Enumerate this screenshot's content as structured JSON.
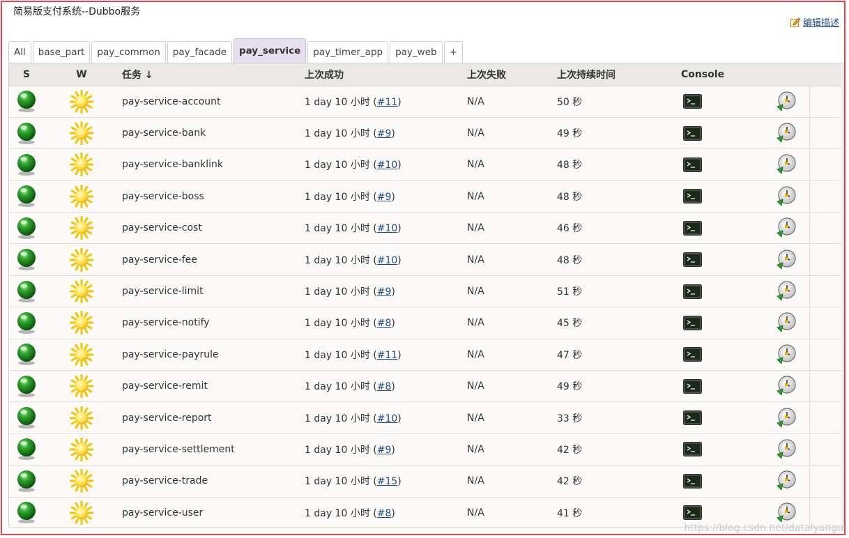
{
  "page": {
    "title": "简易版支付系统--Dubbo服务",
    "edit_description": "编辑描述",
    "watermark": "https://blog.csdn.net/datalyangu"
  },
  "tabs": [
    {
      "label": "All",
      "active": false
    },
    {
      "label": "base_part",
      "active": false
    },
    {
      "label": "pay_common",
      "active": false
    },
    {
      "label": "pay_facade",
      "active": false
    },
    {
      "label": "pay_service",
      "active": true
    },
    {
      "label": "pay_timer_app",
      "active": false
    },
    {
      "label": "pay_web",
      "active": false
    },
    {
      "label": "+",
      "active": false
    }
  ],
  "table": {
    "headers": {
      "status": "S",
      "weather": "W",
      "name": "任务 ↓",
      "last_success": "上次成功",
      "last_failure": "上次失败",
      "last_duration": "上次持续时间",
      "console": "Console"
    },
    "rows": [
      {
        "name": "pay-service-account",
        "success_prefix": "1 day 10 小时 (",
        "build": "#11",
        "success_suffix": ")",
        "failure": "N/A",
        "duration": "50 秒"
      },
      {
        "name": "pay-service-bank",
        "success_prefix": "1 day 10 小时 (",
        "build": "#9",
        "success_suffix": ")",
        "failure": "N/A",
        "duration": "49 秒"
      },
      {
        "name": "pay-service-banklink",
        "success_prefix": "1 day 10 小时 (",
        "build": "#10",
        "success_suffix": ")",
        "failure": "N/A",
        "duration": "48 秒"
      },
      {
        "name": "pay-service-boss",
        "success_prefix": "1 day 10 小时 (",
        "build": "#9",
        "success_suffix": ")",
        "failure": "N/A",
        "duration": "48 秒"
      },
      {
        "name": "pay-service-cost",
        "success_prefix": "1 day 10 小时 (",
        "build": "#10",
        "success_suffix": ")",
        "failure": "N/A",
        "duration": "46 秒"
      },
      {
        "name": "pay-service-fee",
        "success_prefix": "1 day 10 小时 (",
        "build": "#10",
        "success_suffix": ")",
        "failure": "N/A",
        "duration": "48 秒"
      },
      {
        "name": "pay-service-limit",
        "success_prefix": "1 day 10 小时 (",
        "build": "#9",
        "success_suffix": ")",
        "failure": "N/A",
        "duration": "51 秒"
      },
      {
        "name": "pay-service-notify",
        "success_prefix": "1 day 10 小时 (",
        "build": "#8",
        "success_suffix": ")",
        "failure": "N/A",
        "duration": "45 秒"
      },
      {
        "name": "pay-service-payrule",
        "success_prefix": "1 day 10 小时 (",
        "build": "#11",
        "success_suffix": ")",
        "failure": "N/A",
        "duration": "47 秒"
      },
      {
        "name": "pay-service-remit",
        "success_prefix": "1 day 10 小时 (",
        "build": "#8",
        "success_suffix": ")",
        "failure": "N/A",
        "duration": "49 秒"
      },
      {
        "name": "pay-service-report",
        "success_prefix": "1 day 10 小时 (",
        "build": "#10",
        "success_suffix": ")",
        "failure": "N/A",
        "duration": "33 秒"
      },
      {
        "name": "pay-service-settlement",
        "success_prefix": "1 day 10 小时 (",
        "build": "#9",
        "success_suffix": ")",
        "failure": "N/A",
        "duration": "42 秒"
      },
      {
        "name": "pay-service-trade",
        "success_prefix": "1 day 10 小时 (",
        "build": "#15",
        "success_suffix": ")",
        "failure": "N/A",
        "duration": "42 秒"
      },
      {
        "name": "pay-service-user",
        "success_prefix": "1 day 10 小时 (",
        "build": "#8",
        "success_suffix": ")",
        "failure": "N/A",
        "duration": "41 秒"
      }
    ]
  },
  "icons": {
    "status": "green-ball-icon",
    "weather": "sunny-icon",
    "console": "terminal-icon",
    "schedule": "clock-build-icon"
  },
  "colors": {
    "frame": "#e8434b",
    "link": "#204a87",
    "active_tab": "#e6e0ee",
    "status_ok": "#1e8a1e",
    "weather_sun": "#f7c600"
  }
}
